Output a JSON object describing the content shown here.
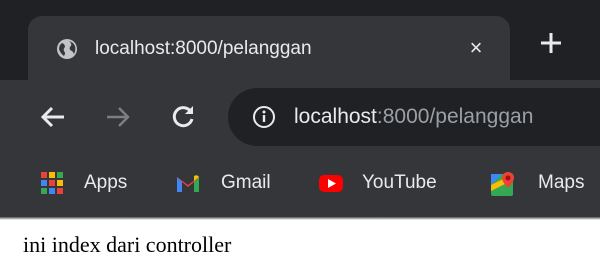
{
  "tab": {
    "title": "localhost:8000/pelanggan",
    "close": "×"
  },
  "toolbar": {
    "url_host": "localhost",
    "url_rest": ":8000/pelanggan"
  },
  "bookmarks": [
    {
      "label": "Apps",
      "icon": "apps-grid-icon"
    },
    {
      "label": "Gmail",
      "icon": "gmail-icon"
    },
    {
      "label": "YouTube",
      "icon": "youtube-icon"
    },
    {
      "label": "Maps",
      "icon": "maps-icon"
    }
  ],
  "page": {
    "text": "ini index dari controller"
  },
  "colors": {
    "frame": "#202124",
    "toolbar": "#35363a",
    "text_primary": "#e8eaed",
    "text_muted": "#9aa0a6"
  }
}
